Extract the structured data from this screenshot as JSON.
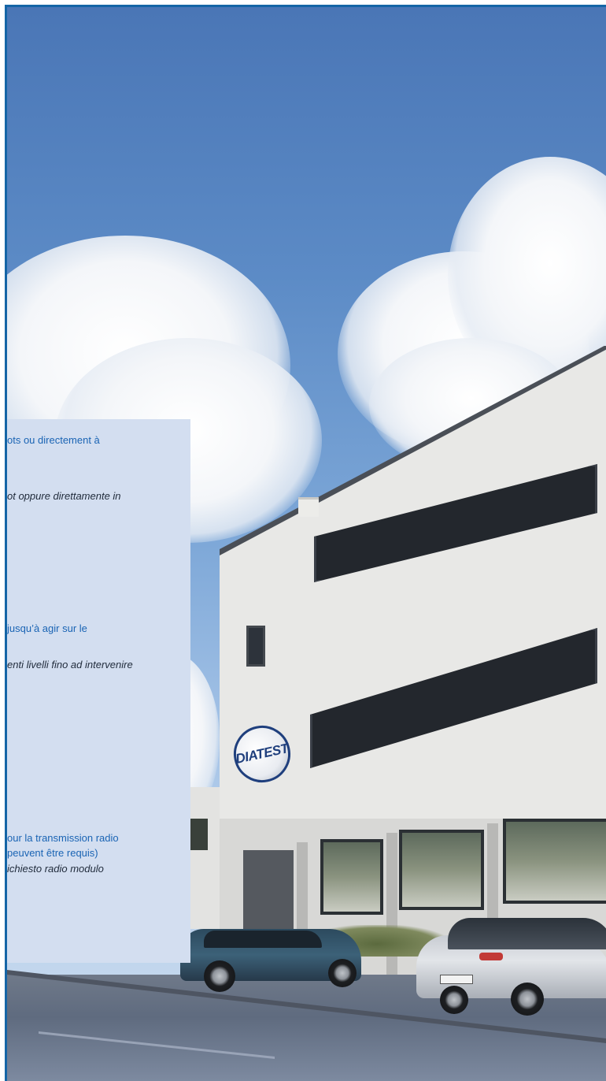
{
  "logo": {
    "text": "DIATEST"
  },
  "panel": {
    "lines": [
      "ots ou directement à",
      "ot oppure direttamente in",
      "jusqu’à agir sur le",
      "enti livelli fino ad intervenire",
      "our la transmission radio",
      "peuvent être requis)",
      "ichiesto radio modulo"
    ]
  },
  "colors": {
    "frame_border": "#1565a6",
    "panel_background": "#d3def0",
    "panel_text_blue": "#1a64b4",
    "panel_text_dark": "#1f2a3a",
    "logo_navy": "#1f3f7d"
  }
}
